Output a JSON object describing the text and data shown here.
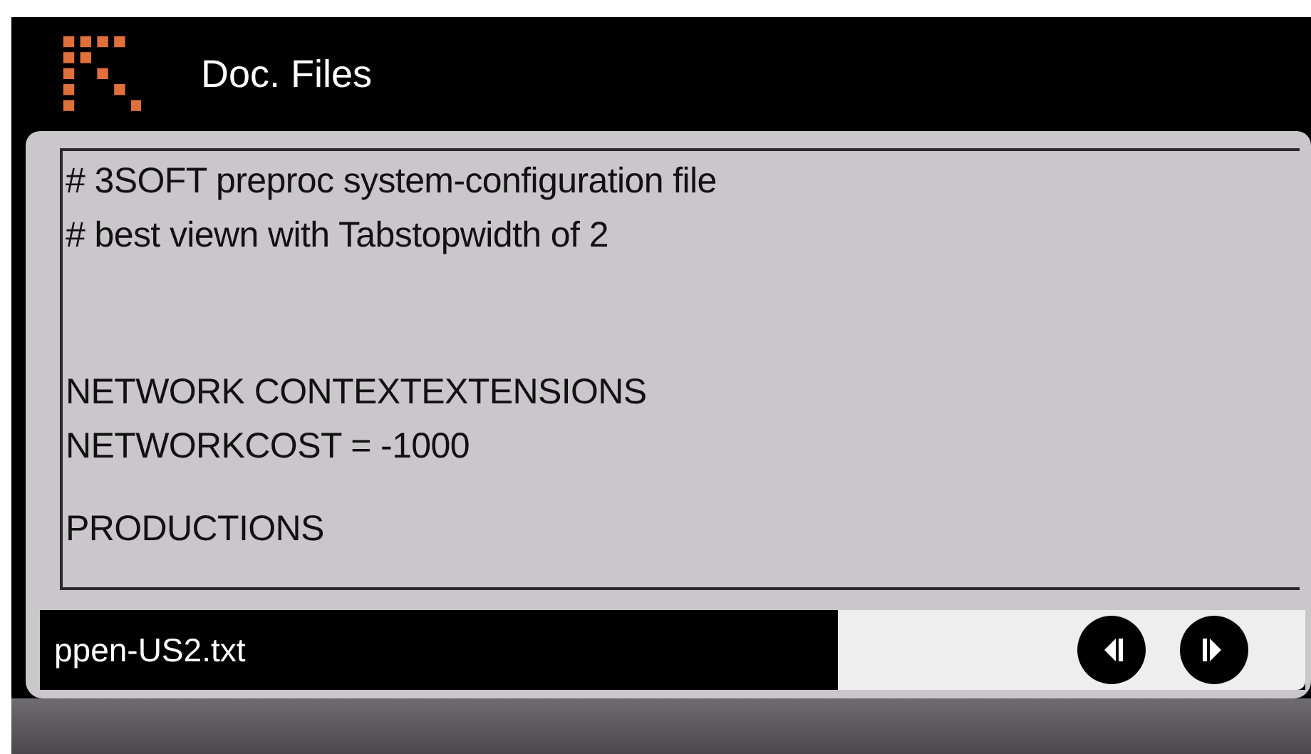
{
  "header": {
    "title": "Doc. Files"
  },
  "document": {
    "blocks": [
      {
        "lines": [
          "# 3SOFT preproc system-configuration file",
          "# best viewn with Tabstopwidth of 2"
        ]
      },
      {
        "lines": [
          "NETWORK CONTEXTEXTENSIONS",
          "NETWORKCOST = -1000"
        ]
      },
      {
        "lines": [
          "PRODUCTIONS"
        ]
      }
    ]
  },
  "footer": {
    "filename": "ppen-US2.txt",
    "buttons": [
      {
        "kind": "previous"
      },
      {
        "kind": "next"
      }
    ]
  }
}
